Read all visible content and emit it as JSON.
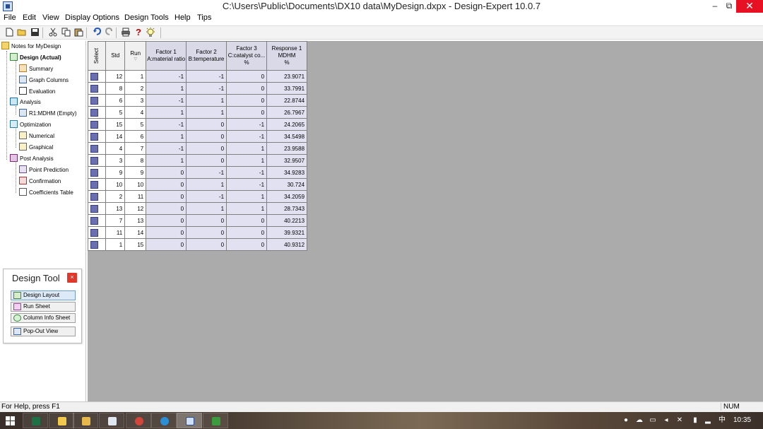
{
  "window": {
    "title": "C:\\Users\\Public\\Documents\\DX10 data\\MyDesign.dxpx - Design-Expert 10.0.7",
    "minimize_glyph": "–",
    "restore_glyph": "⧉",
    "close_glyph": "✕"
  },
  "menu": [
    "File",
    "Edit",
    "View",
    "Display Options",
    "Design Tools",
    "Help",
    "Tips"
  ],
  "toolbar": {
    "icons": [
      "new-file-icon",
      "open-folder-icon",
      "save-icon",
      "cut-icon",
      "copy-icon",
      "paste-icon",
      "undo-icon",
      "redo-icon",
      "print-icon",
      "help-icon",
      "tip-lightbulb-icon"
    ],
    "help_glyph": "?"
  },
  "tree": {
    "root": "Notes for MyDesign",
    "design": "Design (Actual)",
    "summary": "Summary",
    "graph_columns": "Graph Columns",
    "evaluation": "Evaluation",
    "analysis": "Analysis",
    "r1": "R1:MDHM (Empty)",
    "optimization": "Optimization",
    "numerical": "Numerical",
    "graphical": "Graphical",
    "post_analysis": "Post Analysis",
    "point_prediction": "Point Prediction",
    "confirmation": "Confirmation",
    "coefficients_table": "Coefficients Table"
  },
  "design_tool": {
    "title": "Design Tool",
    "close_glyph": "×",
    "buttons": [
      "Design Layout",
      "Run Sheet",
      "Column Info Sheet",
      "Pop-Out View"
    ]
  },
  "grid": {
    "headers": {
      "select": "Select",
      "std": "Std",
      "run": "Run",
      "factor1": [
        "Factor 1",
        "A:material ratio",
        ""
      ],
      "factor2": [
        "Factor 2",
        "B:temperature",
        ""
      ],
      "factor3": [
        "Factor 3",
        "C:catalyst co...",
        "%"
      ],
      "response1": [
        "Response 1",
        "MDHM",
        "%"
      ]
    },
    "rows": [
      {
        "std": "12",
        "run": "1",
        "a": "-1",
        "b": "-1",
        "c": "0",
        "r": "23.9071"
      },
      {
        "std": "8",
        "run": "2",
        "a": "1",
        "b": "-1",
        "c": "0",
        "r": "33.7991"
      },
      {
        "std": "6",
        "run": "3",
        "a": "-1",
        "b": "1",
        "c": "0",
        "r": "22.8744"
      },
      {
        "std": "5",
        "run": "4",
        "a": "1",
        "b": "1",
        "c": "0",
        "r": "26.7967"
      },
      {
        "std": "15",
        "run": "5",
        "a": "-1",
        "b": "0",
        "c": "-1",
        "r": "24.2065"
      },
      {
        "std": "14",
        "run": "6",
        "a": "1",
        "b": "0",
        "c": "-1",
        "r": "34.5498"
      },
      {
        "std": "4",
        "run": "7",
        "a": "-1",
        "b": "0",
        "c": "1",
        "r": "23.9588"
      },
      {
        "std": "3",
        "run": "8",
        "a": "1",
        "b": "0",
        "c": "1",
        "r": "32.9507"
      },
      {
        "std": "9",
        "run": "9",
        "a": "0",
        "b": "-1",
        "c": "-1",
        "r": "34.9283"
      },
      {
        "std": "10",
        "run": "10",
        "a": "0",
        "b": "1",
        "c": "-1",
        "r": "30.724"
      },
      {
        "std": "2",
        "run": "11",
        "a": "0",
        "b": "-1",
        "c": "1",
        "r": "34.2059"
      },
      {
        "std": "13",
        "run": "12",
        "a": "0",
        "b": "1",
        "c": "1",
        "r": "28.7343"
      },
      {
        "std": "7",
        "run": "13",
        "a": "0",
        "b": "0",
        "c": "0",
        "r": "40.2213"
      },
      {
        "std": "11",
        "run": "14",
        "a": "0",
        "b": "0",
        "c": "0",
        "r": "39.9321"
      },
      {
        "std": "1",
        "run": "15",
        "a": "0",
        "b": "0",
        "c": "0",
        "r": "40.9312"
      }
    ]
  },
  "status": {
    "help_text": "For Help, press F1",
    "num": "NUM"
  },
  "taskbar": {
    "clock": "10:35",
    "tray_lang": "中",
    "apps": [
      "excel-icon",
      "favorites-icon",
      "file-explorer-icon",
      "window-icon",
      "paint-icon",
      "browser-icon",
      "design-expert-icon",
      "excel-green-icon"
    ]
  },
  "colors": {
    "select_box": "#6b6fb0",
    "factor_cell": "#e1e1f1",
    "grid_background": "#ababab",
    "close_red": "#e81123"
  }
}
